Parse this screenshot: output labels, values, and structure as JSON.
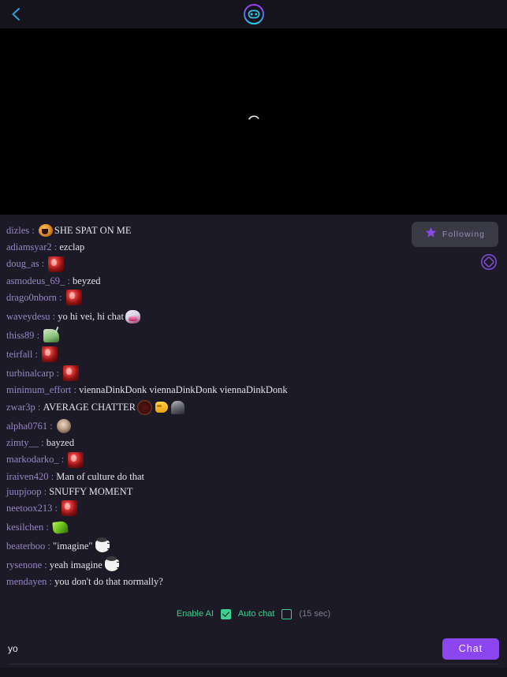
{
  "header": {
    "back_icon": "chevron-left-icon",
    "logo_icon": "bot-logo-icon",
    "back_color": "#2f9fd6",
    "logo_top_color": "#a23bf0",
    "logo_bottom_color": "#2fb6e0"
  },
  "video": {
    "state_icon": "loading-spinner-icon",
    "background": "#000000"
  },
  "overlay": {
    "following_label": "Following",
    "following_icon": "star-icon",
    "following_icon_color": "#8b46f0",
    "rotate_icon": "screen-rotation-icon",
    "rotate_icon_color": "#7d49c9"
  },
  "chat": {
    "username_color": "#9887c4",
    "text_color": "#e4e4ec",
    "background": "#1b1a26",
    "messages": [
      {
        "user": "dizles",
        "sep": " : ",
        "emotes_before": [
          "emote-orange-face"
        ],
        "text": "SHE SPAT ON ME",
        "emotes_after": []
      },
      {
        "user": "adiamsyar2",
        "sep": " : ",
        "emotes_before": [],
        "text": "ezclap",
        "emotes_after": []
      },
      {
        "user": "doug_as",
        "sep": " : ",
        "emotes_before": [],
        "text": "",
        "emotes_after": [
          "emote-red"
        ]
      },
      {
        "user": "asmodeus_69_",
        "sep": " : ",
        "emotes_before": [],
        "text": "beyzed",
        "emotes_after": []
      },
      {
        "user": "drago0nborn",
        "sep": " : ",
        "emotes_before": [],
        "text": "",
        "emotes_after": [
          "emote-red"
        ]
      },
      {
        "user": "waveydesu",
        "sep": " : ",
        "emotes_before": [],
        "text": "yo hi vei, hi chat",
        "emotes_after": [
          "emote-anime"
        ]
      },
      {
        "user": "thiss89",
        "sep": " : ",
        "emotes_before": [],
        "text": "",
        "emotes_after": [
          "emote-lamp"
        ]
      },
      {
        "user": "teirfall",
        "sep": " : ",
        "emotes_before": [],
        "text": "",
        "emotes_after": [
          "emote-red"
        ]
      },
      {
        "user": "turbinalcarp",
        "sep": " : ",
        "emotes_before": [],
        "text": "",
        "emotes_after": [
          "emote-red"
        ]
      },
      {
        "user": "minimum_effort",
        "sep": " : ",
        "emotes_before": [],
        "text": "viennaDinkDonk viennaDinkDonk viennaDinkDonk",
        "emotes_after": []
      },
      {
        "user": "zwar3p",
        "sep": " : ",
        "emotes_before": [],
        "text": "AVERAGE CHATTER",
        "emotes_after": [
          "emote-dark-circle",
          "emote-point-right",
          "emote-gray-figure"
        ]
      },
      {
        "user": "alpha0761",
        "sep": " : ",
        "emotes_before": [],
        "text": "",
        "emotes_after": [
          "emote-face"
        ]
      },
      {
        "user": "zimty__",
        "sep": " : ",
        "emotes_before": [],
        "text": "bayzed",
        "emotes_after": []
      },
      {
        "user": "markodarko_",
        "sep": " : ",
        "emotes_before": [],
        "text": "",
        "emotes_after": [
          "emote-red"
        ]
      },
      {
        "user": "iraiven420",
        "sep": " : ",
        "emotes_before": [],
        "text": "Man of culture do that",
        "emotes_after": []
      },
      {
        "user": "juupjoop",
        "sep": " : ",
        "emotes_before": [],
        "text": "SNUFFY MOMENT",
        "emotes_after": []
      },
      {
        "user": "neetoox213",
        "sep": " : ",
        "emotes_before": [],
        "text": "",
        "emotes_after": [
          "emote-red"
        ]
      },
      {
        "user": "kesilchen",
        "sep": " : ",
        "emotes_before": [],
        "text": "",
        "emotes_after": [
          "emote-green"
        ]
      },
      {
        "user": "beaterboo",
        "sep": " : ",
        "emotes_before": [],
        "text": "\"imagine\"",
        "emotes_after": [
          "emote-cup"
        ]
      },
      {
        "user": "rysenone",
        "sep": " : ",
        "emotes_before": [],
        "text": "yeah imagine",
        "emotes_after": [
          "emote-cup"
        ]
      },
      {
        "user": "mendayen",
        "sep": " : ",
        "emotes_before": [],
        "text": "you don't do that normally?",
        "emotes_after": []
      }
    ]
  },
  "controls": {
    "enable_ai_label": "Enable AI",
    "enable_ai_checked": true,
    "auto_chat_label": "Auto chat",
    "auto_chat_checked": false,
    "interval_note": "(15 sec)",
    "accent_color": "#3fcf8e"
  },
  "input": {
    "value": "yo",
    "placeholder": "",
    "send_label": "Chat",
    "send_color": "#8b46f0"
  }
}
